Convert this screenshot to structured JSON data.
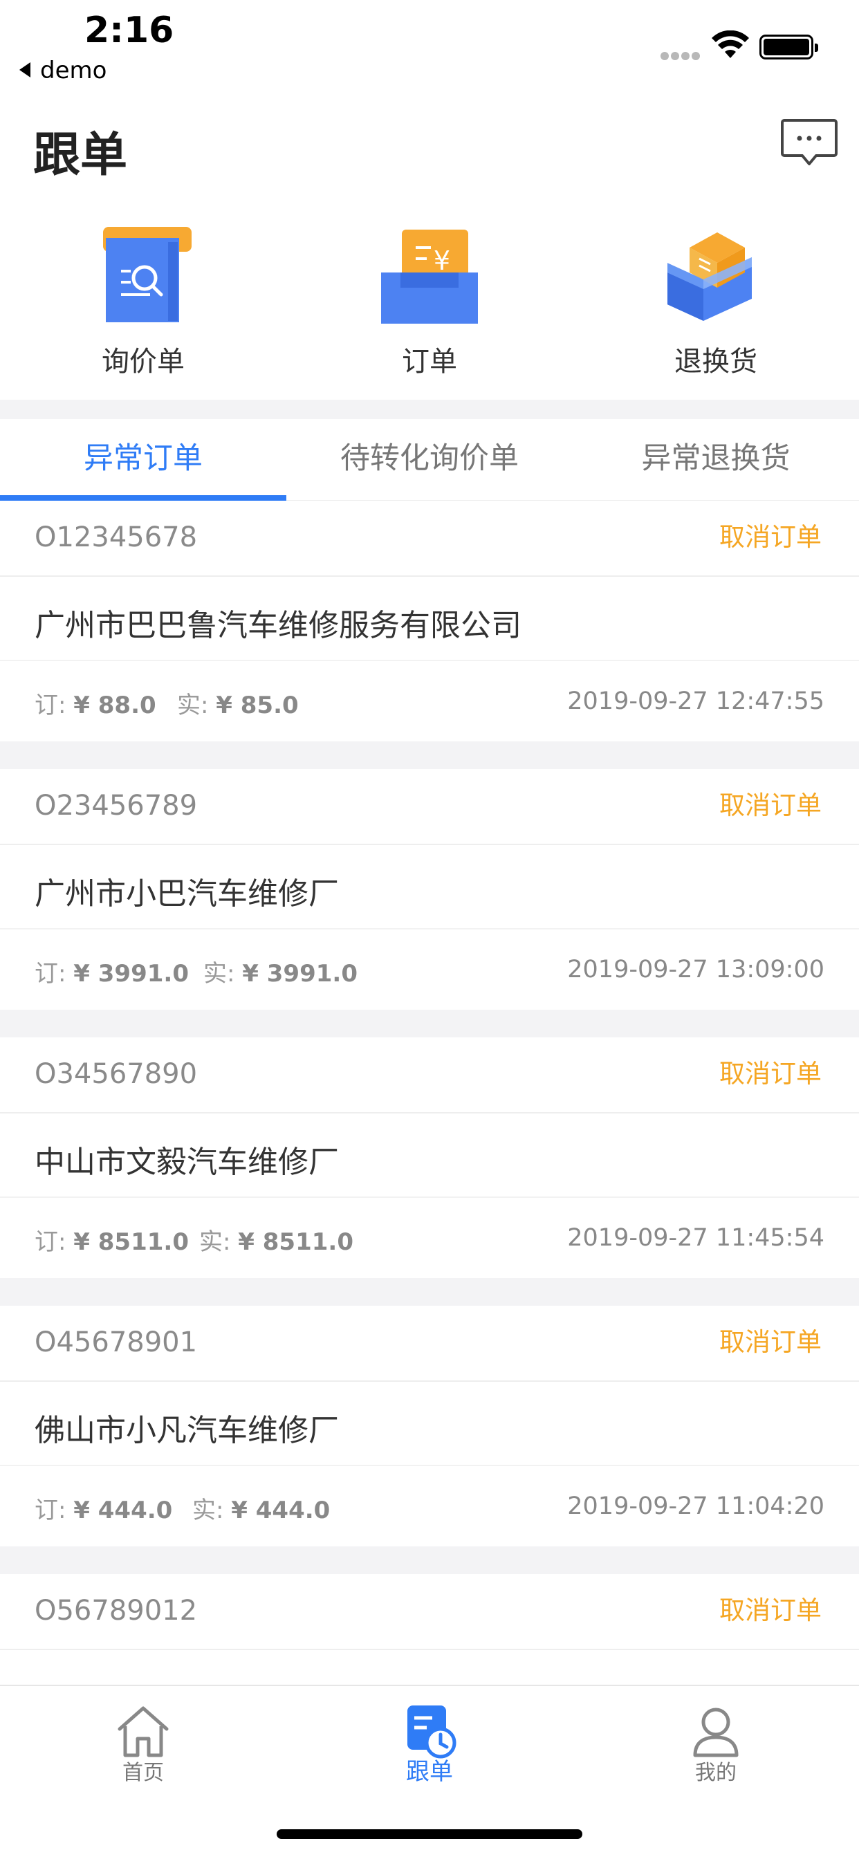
{
  "status_bar": {
    "time": "2:16",
    "back_app": "demo"
  },
  "header": {
    "title": "跟单",
    "message_icon": "chat-bubble-icon"
  },
  "shortcuts": [
    {
      "label": "询价单",
      "icon": "inquiry-doc-icon"
    },
    {
      "label": "订单",
      "icon": "order-tray-icon"
    },
    {
      "label": "退换货",
      "icon": "return-box-icon"
    }
  ],
  "tabs": [
    {
      "label": "异常订单",
      "active": true
    },
    {
      "label": "待转化询价单",
      "active": false
    },
    {
      "label": "异常退换货",
      "active": false
    }
  ],
  "orders": [
    {
      "order_no": "O12345678",
      "cancel_label": "取消订单",
      "company": "广州市巴巴鲁汽车维修服务有限公司",
      "order_price_label": "订:",
      "order_price": "¥ 88.0",
      "actual_price_label": "实:",
      "actual_price": "¥ 85.0",
      "time": "2019-09-27 12:47:55"
    },
    {
      "order_no": "O23456789",
      "cancel_label": "取消订单",
      "company": "广州市小巴汽车维修厂",
      "order_price_label": "订:",
      "order_price": "¥ 3991.0",
      "actual_price_label": "实:",
      "actual_price": "¥ 3991.0",
      "time": "2019-09-27 13:09:00"
    },
    {
      "order_no": "O34567890",
      "cancel_label": "取消订单",
      "company": "中山市文毅汽车维修厂",
      "order_price_label": "订:",
      "order_price": "¥ 8511.0",
      "actual_price_label": "实:",
      "actual_price": "¥ 8511.0",
      "time": "2019-09-27 11:45:54"
    },
    {
      "order_no": "O45678901",
      "cancel_label": "取消订单",
      "company": "佛山市小凡汽车维修厂",
      "order_price_label": "订:",
      "order_price": "¥ 444.0",
      "actual_price_label": "实:",
      "actual_price": "¥ 444.0",
      "time": "2019-09-27 11:04:20"
    },
    {
      "order_no": "O56789012",
      "cancel_label": "取消订单"
    }
  ],
  "tab_bar": [
    {
      "label": "首页",
      "icon": "home-icon",
      "active": false
    },
    {
      "label": "跟单",
      "icon": "follow-order-icon",
      "active": true
    },
    {
      "label": "我的",
      "icon": "profile-icon",
      "active": false
    }
  ],
  "colors": {
    "accent": "#2f7cf6",
    "cancel": "#f5a623",
    "gap": "#f3f3f5"
  }
}
